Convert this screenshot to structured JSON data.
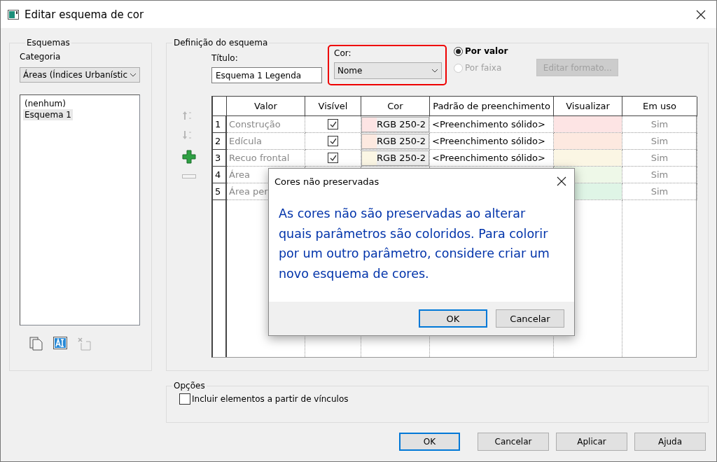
{
  "window": {
    "title": "Editar esquema de cor"
  },
  "schemes": {
    "group_title": "Esquemas",
    "category_label": "Categoria",
    "category": "Áreas (Índices Urbanístic",
    "items": [
      {
        "label": "(nenhum)",
        "selected": false
      },
      {
        "label": "Esquema 1",
        "selected": true
      }
    ],
    "tools": [
      {
        "kind": "duplicate",
        "disabled": false
      },
      {
        "kind": "rename",
        "disabled": false
      },
      {
        "kind": "delete",
        "disabled": true
      }
    ]
  },
  "definition": {
    "group_title": "Definição do esquema",
    "title_label": "Título:",
    "title_value": "Esquema 1 Legenda",
    "color_label": "Cor:",
    "color_value": "Nome",
    "color_highlighted": true,
    "modes": [
      {
        "label": "Por valor",
        "selected": true,
        "disabled": false
      },
      {
        "label": "Por faixa",
        "selected": false,
        "disabled": true
      }
    ],
    "edit_format_button": {
      "label": "Editar formato...",
      "disabled": true
    },
    "tools": [
      {
        "kind": "move-up",
        "disabled": true
      },
      {
        "kind": "move-down",
        "disabled": true
      },
      {
        "kind": "add",
        "disabled": false
      },
      {
        "kind": "remove",
        "disabled": true
      }
    ],
    "table": {
      "columns": [
        "Valor",
        "Visível",
        "Cor",
        "Padrão de preenchimento",
        "Visualizar",
        "Em uso"
      ],
      "rows": [
        {
          "number": "1",
          "value": "Construção",
          "visible": true,
          "color_label": "RGB 250-2",
          "pattern": "<Preenchimento sólido>",
          "color": "#fde4e4",
          "in_use": "Sim"
        },
        {
          "number": "2",
          "value": "Edícula",
          "visible": true,
          "color_label": "RGB 250-2",
          "pattern": "<Preenchimento sólido>",
          "color": "#fde9e0",
          "in_use": "Sim"
        },
        {
          "number": "3",
          "value": "Recuo frontal",
          "visible": true,
          "color_label": "RGB 250-2",
          "pattern": "<Preenchimento sólido>",
          "color": "#fbf6e4",
          "in_use": "Sim"
        },
        {
          "number": "4",
          "value": "Área",
          "color": "#eef8e8",
          "in_use": "Sim"
        },
        {
          "number": "5",
          "value": "Área per",
          "color": "#dff5e6",
          "in_use": "Sim"
        }
      ]
    }
  },
  "options": {
    "group_title": "Opções",
    "include_links": {
      "label": "Incluir elementos a partir de vínculos",
      "checked": false
    }
  },
  "buttons": [
    {
      "label": "OK",
      "default": true
    },
    {
      "label": "Cancelar",
      "default": false
    },
    {
      "label": "Aplicar",
      "default": false
    },
    {
      "label": "Ajuda",
      "default": false
    }
  ],
  "alert": {
    "title": "Cores não preservadas",
    "message": "As cores não são preservadas ao alterar quais parâmetros são coloridos. Para colorir por um outro parâmetro, considere criar um novo esquema de cores.",
    "buttons": [
      {
        "label": "OK",
        "default": true
      },
      {
        "label": "Cancelar",
        "default": false
      }
    ]
  }
}
